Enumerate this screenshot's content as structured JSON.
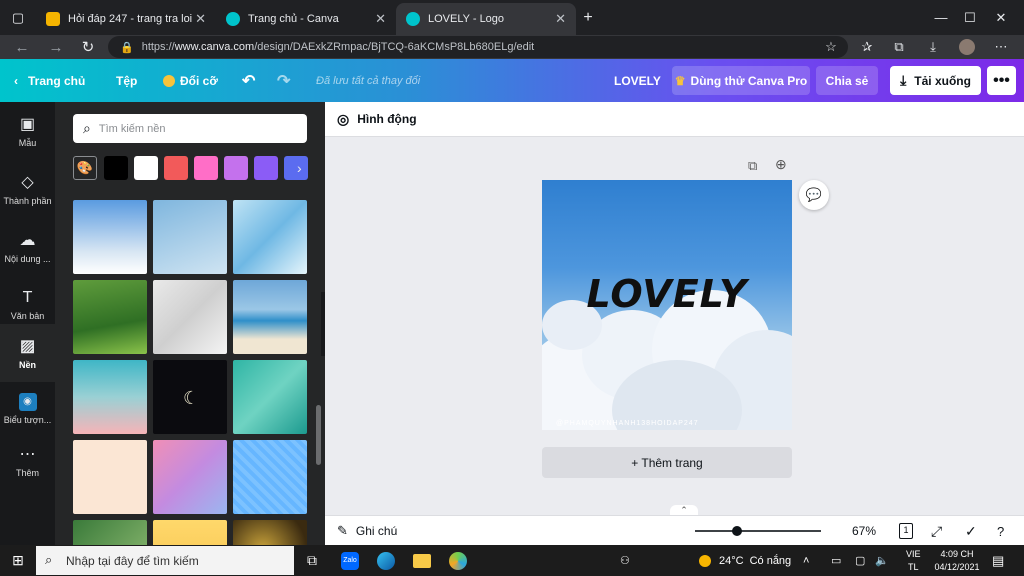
{
  "browser": {
    "tabs": [
      {
        "title": "Hỏi đáp 247 - trang tra loi",
        "active": false
      },
      {
        "title": "Trang chủ - Canva",
        "active": false
      },
      {
        "title": "LOVELY - Logo",
        "active": true
      }
    ],
    "url_prefix": "https://",
    "url_host": "www.canva.com",
    "url_path": "/design/DAExkZRmpac/BjTCQ-6aKCMsP8Lb680ELg/edit"
  },
  "canva_header": {
    "home": "Trang chủ",
    "file": "Tệp",
    "resize": "Đổi cỡ",
    "saved_status": "Đã lưu tất cả thay đổi",
    "design_name": "LOVELY",
    "try_pro": "Dùng thử Canva Pro",
    "share": "Chia sẻ",
    "download": "Tải xuống"
  },
  "left_rail": [
    {
      "label": "Mẫu",
      "icon": "template-icon"
    },
    {
      "label": "Thành phần",
      "icon": "elements-icon"
    },
    {
      "label": "Nội dung ...",
      "icon": "upload-icon"
    },
    {
      "label": "Văn bản",
      "icon": "text-icon"
    },
    {
      "label": "Nền",
      "icon": "background-icon",
      "active": true
    },
    {
      "label": "Biểu tượn...",
      "icon": "logo-icon"
    },
    {
      "label": "Thêm",
      "icon": "more-icon"
    }
  ],
  "panel": {
    "search_placeholder": "Tìm kiếm nền",
    "swatches": [
      "#000000",
      "#ffffff",
      "#f25a5a",
      "#ff6ec7",
      "#c471ed",
      "#8b5cf6",
      "#5b6cf0"
    ]
  },
  "editor": {
    "animate": "Hình động",
    "design_text": "LOVELY",
    "watermark": "@PHAMQUYNHANH138HOIDAP247",
    "add_page": "+ Thêm trang",
    "notes": "Ghi chú",
    "zoom": "67%",
    "page_count": "1",
    "zoom_level": 0.33
  },
  "taskbar": {
    "search_placeholder": "Nhập tại đây để tìm kiếm",
    "weather_temp": "24°C",
    "weather_text": "Có nắng",
    "lang_top": "VIE",
    "lang_bottom": "TL",
    "time": "4:09 CH",
    "date": "04/12/2021"
  }
}
